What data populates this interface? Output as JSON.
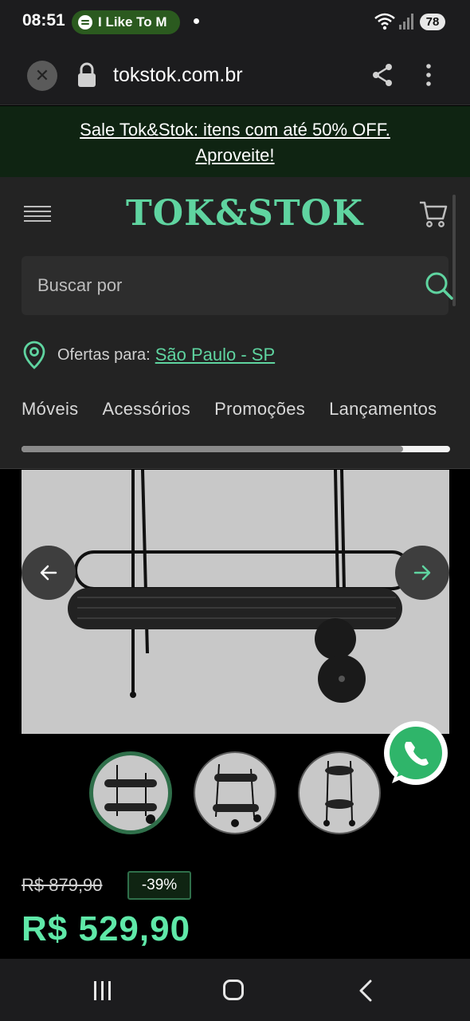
{
  "status_bar": {
    "time": "08:51",
    "media_text": "I Like To M",
    "battery": "78"
  },
  "browser": {
    "url": "tokstok.com.br"
  },
  "banner": {
    "text_line1": "Sale Tok&Stok: itens com até 50% OFF.",
    "text_line2": "Aproveite!"
  },
  "header": {
    "logo": "TOK&STOK",
    "search_placeholder": "Buscar por",
    "location_label": "Ofertas para:",
    "location_city": "São Paulo - SP"
  },
  "categories": [
    "Móveis",
    "Acessórios",
    "Promoções",
    "Lançamentos"
  ],
  "category_scroll": {
    "position": 0.89
  },
  "product": {
    "old_price": "R$ 879,90",
    "discount": "-39%",
    "price": "R$ 529,90"
  },
  "colors": {
    "brand_green": "#5fd4a0",
    "price_green": "#5fe8a8",
    "banner_bg": "#0f2412"
  }
}
